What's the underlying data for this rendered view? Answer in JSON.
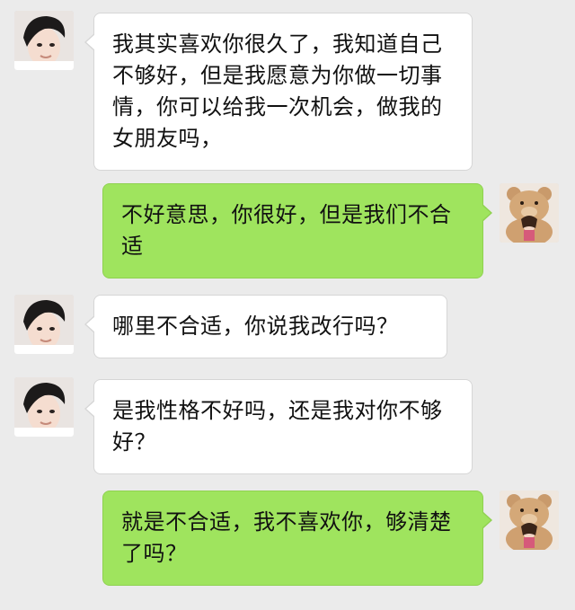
{
  "chat": {
    "messages": [
      {
        "side": "in",
        "avatar": "boy-avatar",
        "text": "我其实喜欢你很久了，我知道自己不够好，但是我愿意为你做一切事情，你可以给我一次机会，做我的女朋友吗，"
      },
      {
        "side": "out",
        "avatar": "girl-with-teddy-bear-avatar",
        "text": "不好意思，你很好，但是我们不合适"
      },
      {
        "side": "in",
        "avatar": "boy-avatar",
        "text": "哪里不合适，你说我改行吗？"
      },
      {
        "side": "in",
        "avatar": "boy-avatar",
        "text": "是我性格不好吗，还是我对你不够好？"
      },
      {
        "side": "out",
        "avatar": "girl-with-teddy-bear-avatar",
        "text": "就是不合适，我不喜欢你，够清楚了吗？"
      }
    ]
  },
  "colors": {
    "background": "#ebebeb",
    "incoming_bubble": "#ffffff",
    "outgoing_bubble": "#9fe45e",
    "text": "#111111"
  }
}
